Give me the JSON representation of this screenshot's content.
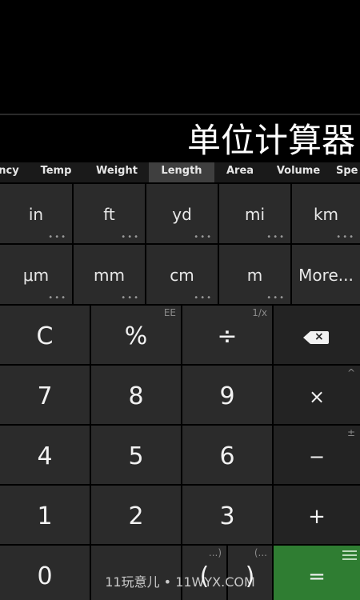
{
  "header": {
    "title": "单位计算器"
  },
  "tabs": [
    {
      "label": "ncy",
      "active": false
    },
    {
      "label": "Temp",
      "active": false
    },
    {
      "label": "Weight",
      "active": false
    },
    {
      "label": "Length",
      "active": true
    },
    {
      "label": "Area",
      "active": false
    },
    {
      "label": "Volume",
      "active": false
    },
    {
      "label": "Spe",
      "active": false
    }
  ],
  "units": [
    {
      "label": "in",
      "dots": "•••"
    },
    {
      "label": "ft",
      "dots": "•••"
    },
    {
      "label": "yd",
      "dots": "•••"
    },
    {
      "label": "mi",
      "dots": "•••"
    },
    {
      "label": "km",
      "dots": "•••"
    },
    {
      "label": "μm",
      "dots": "•••"
    },
    {
      "label": "mm",
      "dots": "•••"
    },
    {
      "label": "cm",
      "dots": "•••"
    },
    {
      "label": "m",
      "dots": "•••"
    },
    {
      "label": "More...",
      "dots": ""
    }
  ],
  "keypad": {
    "clear": "C",
    "percent": "%",
    "percent_alt": "EE",
    "divide": "÷",
    "divide_alt": "1/x",
    "backspace_icon": "backspace-icon",
    "seven": "7",
    "eight": "8",
    "nine": "9",
    "multiply": "×",
    "multiply_alt": "^",
    "four": "4",
    "five": "5",
    "six": "6",
    "minus": "−",
    "minus_alt": "±",
    "one": "1",
    "two": "2",
    "three": "3",
    "plus": "+",
    "zero": "0",
    "paren_open": "(",
    "paren_open_alt": "...)",
    "paren_close": ")",
    "paren_close_alt": "(...",
    "equals": "=",
    "menu_icon": "menu-icon"
  },
  "watermark": "11玩意儿 • 11WYX.COM",
  "colors": {
    "background": "#000000",
    "key": "#2b2b2b",
    "operator_key": "#232323",
    "equals_key": "#2f7d32",
    "active_tab": "#3f3f3f"
  }
}
